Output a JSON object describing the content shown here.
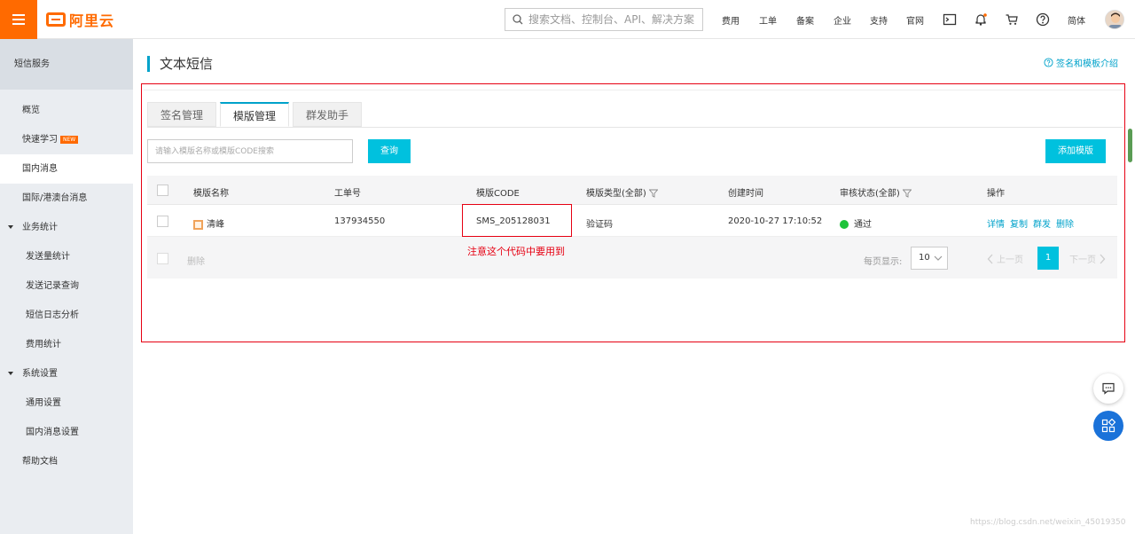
{
  "topbar": {
    "logo_text": "阿里云",
    "search_placeholder": "搜索文档、控制台、API、解决方案",
    "nav": [
      "费用",
      "工单",
      "备案",
      "企业",
      "支持",
      "官网"
    ],
    "lang": "简体",
    "notification_badge": true
  },
  "sidebar": {
    "header": "短信服务",
    "items": [
      {
        "label": "概览"
      },
      {
        "label": "快速学习",
        "badge": "NEW"
      },
      {
        "label": "国内消息",
        "active": true
      },
      {
        "label": "国际/港澳台消息"
      }
    ],
    "groups": [
      {
        "label": "业务统计",
        "items": [
          "发送量统计",
          "发送记录查询",
          "短信日志分析",
          "费用统计"
        ]
      },
      {
        "label": "系统设置",
        "items": [
          "通用设置",
          "国内消息设置"
        ]
      }
    ],
    "footer_item": "帮助文档"
  },
  "main": {
    "title": "文本短信",
    "help_link": "签名和模板介绍",
    "tabs": [
      {
        "label": "签名管理"
      },
      {
        "label": "模版管理",
        "active": true
      },
      {
        "label": "群发助手"
      }
    ],
    "search_placeholder": "请输入模版名称或模版CODE搜索",
    "query_button": "查询",
    "add_button": "添加模版"
  },
  "table": {
    "columns": [
      "模版名称",
      "工单号",
      "模版CODE",
      "模版类型(全部)",
      "创建时间",
      "审核状态(全部)",
      "操作"
    ],
    "rows": [
      {
        "name": "清峰",
        "ticket": "137934550",
        "code": "SMS_205128031",
        "type": "验证码",
        "created": "2020-10-27 17:10:52",
        "status": "通过",
        "actions": [
          "详情",
          "复制",
          "群发",
          "删除"
        ]
      }
    ],
    "bulk_delete": "删除",
    "per_page_label": "每页显示:",
    "per_page_value": "10",
    "prev": "上一页",
    "next": "下一页",
    "current_page": "1"
  },
  "annotation": "注意这个代码中要用到",
  "watermark": "https://blog.csdn.net/weixin_45019350",
  "colors": {
    "brand": "#ff6a00",
    "accent": "#00c1de",
    "link": "#00a2ca",
    "highlight": "#e60012",
    "status_ok": "#1ec33a"
  }
}
